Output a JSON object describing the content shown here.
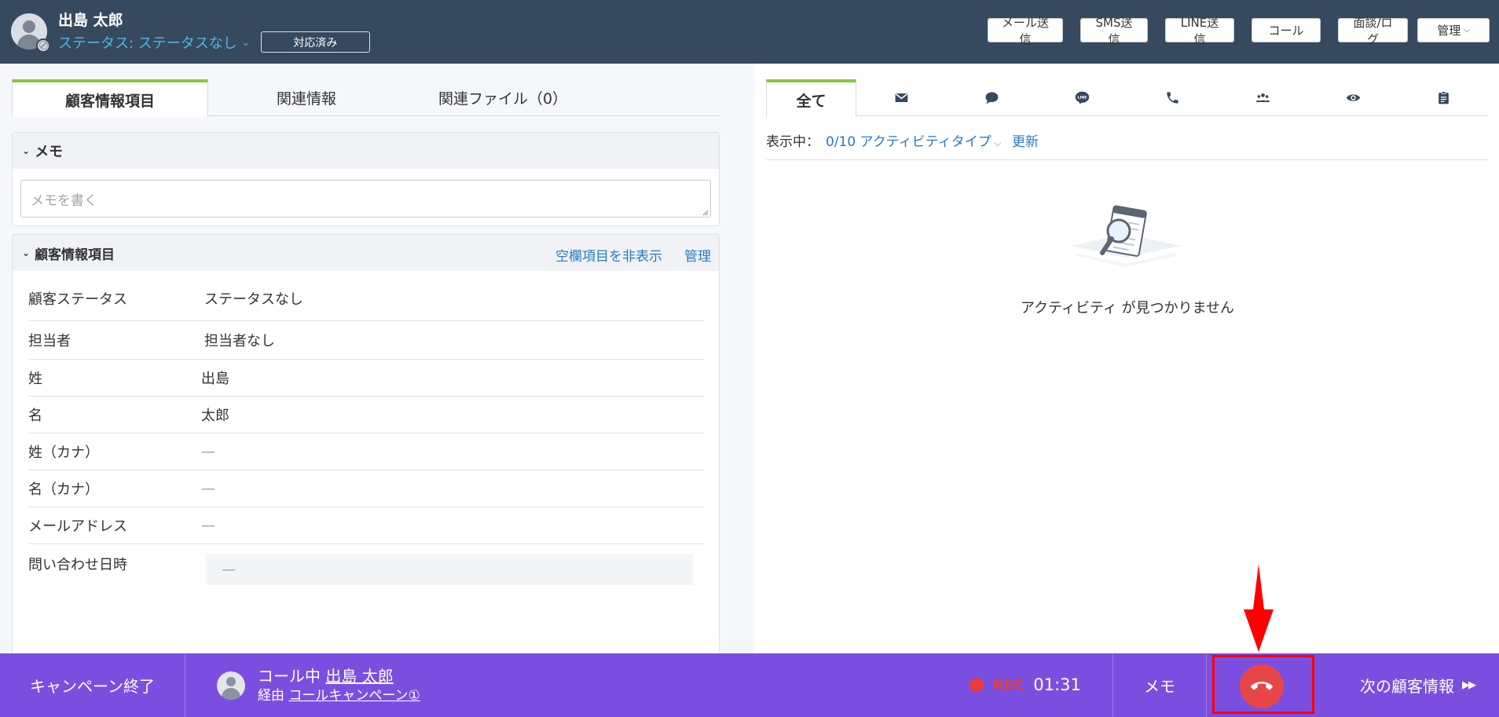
{
  "header": {
    "customer_name": "出島 太郎",
    "status_text": "ステータス: ステータスなし",
    "done_button": "対応済み",
    "actions": [
      "メール送信",
      "SMS送信",
      "LINE送信",
      "コール",
      "面談/ログ"
    ],
    "manage": "管理"
  },
  "left_tabs": [
    "顧客情報項目",
    "関連情報",
    "関連ファイル（0）"
  ],
  "memo": {
    "title": "メモ",
    "placeholder": "メモを書く"
  },
  "customer_info": {
    "title": "顧客情報項目",
    "hide_empty": "空欄項目を非表示",
    "manage": "管理",
    "rows": [
      {
        "label": "顧客ステータス",
        "value": "ステータスなし"
      },
      {
        "label": "担当者",
        "value": "担当者なし"
      },
      {
        "label": "姓",
        "value": "出島"
      },
      {
        "label": "名",
        "value": "太郎"
      },
      {
        "label": "姓（カナ）",
        "value": "—"
      },
      {
        "label": "名（カナ）",
        "value": "—"
      },
      {
        "label": "メールアドレス",
        "value": "—"
      },
      {
        "label": "問い合わせ日時",
        "value": "—"
      }
    ]
  },
  "right_tabs": {
    "all": "全て",
    "icons": [
      "mail-icon",
      "chat-icon",
      "line-icon",
      "phone-icon",
      "people-icon",
      "eye-icon",
      "clipboard-icon"
    ]
  },
  "activity_filter": {
    "label": "表示中：",
    "value": "0/10 アクティビティタイプ",
    "update": "更新"
  },
  "empty_state": "アクティビティ が見つかりません",
  "call_bar": {
    "end_campaign": "キャンペーン終了",
    "calling_prefix": "コール中",
    "calling_name": "出島 太郎",
    "via_prefix": "経由",
    "via_campaign": "コールキャンペーン①",
    "rec_label": "REC",
    "rec_time": "01:31",
    "memo": "メモ",
    "next": "次の顧客情報",
    "next_arrows": "▶▶"
  },
  "colors": {
    "header_bg": "#36495e",
    "accent_green": "#8cc63f",
    "link_blue": "#2a79c4",
    "call_bar_bg": "#7a4fe0",
    "hangup_red": "#e84646",
    "highlight_red": "#ff0000"
  }
}
